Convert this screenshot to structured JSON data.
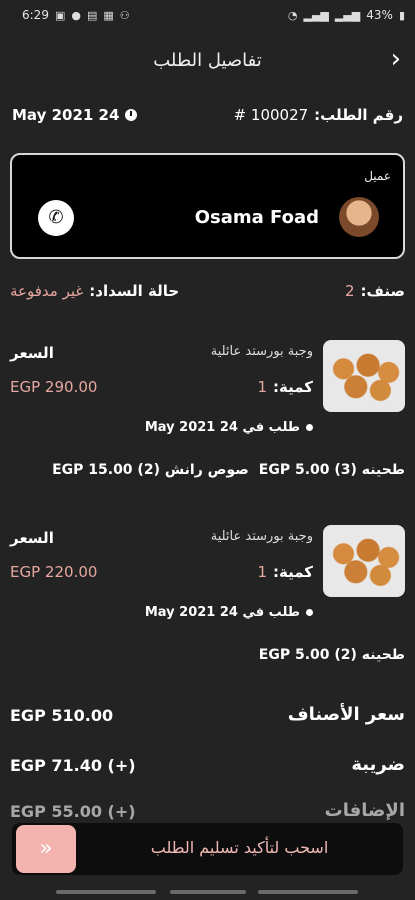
{
  "status_bar": {
    "time": "6:29",
    "battery": "43%"
  },
  "header": {
    "title": "تفاصيل الطلب",
    "back_icon": "chevron-right-icon"
  },
  "order": {
    "date": "May 2021 24",
    "number_label": "رقم الطلب:",
    "number": "# 100027"
  },
  "customer": {
    "label": "عميل",
    "name": "Osama Foad"
  },
  "payment": {
    "status_label": "حالة السداد:",
    "status_value": "غير مدفوعة",
    "category_label": "صنف:",
    "category_count": "2"
  },
  "items": [
    {
      "name": "وجبة بورستد عائلية",
      "price_label": "السعر",
      "qty_label": "كمية:",
      "qty": "1",
      "price": "EGP 290.00",
      "ordered": "طلب في 24 May 2021",
      "addons": [
        "طحينه EGP 5.00 (3)",
        "صوص رانش EGP 15.00 (2)"
      ]
    },
    {
      "name": "وجبة بورستد عائلية",
      "price_label": "السعر",
      "qty_label": "كمية:",
      "qty": "1",
      "price": "EGP 220.00",
      "ordered": "طلب في 24 May 2021",
      "addons": [
        "طحينه EGP 5.00 (2)"
      ]
    }
  ],
  "totals": {
    "items_label": "سعر الأصناف",
    "items_value": "EGP 510.00",
    "tax_label": "ضريبة",
    "tax_value": "EGP 71.40 (+)",
    "extra_label": "الإضافات",
    "extra_value": "EGP 55.00 (+)"
  },
  "bottom": {
    "slide_label": "اسحب لتأكيد تسليم الطلب",
    "slide_icon": "double-chevron-icon"
  }
}
